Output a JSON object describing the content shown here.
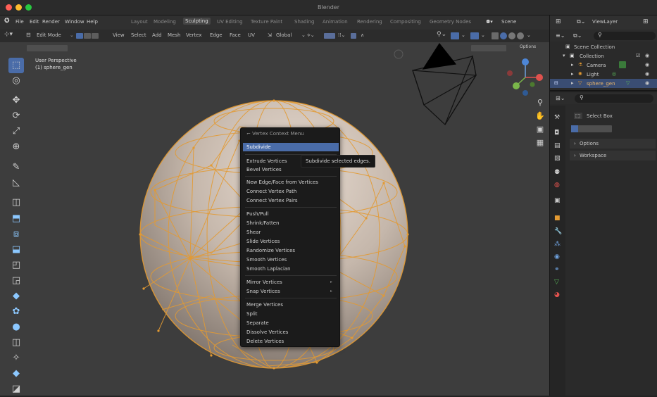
{
  "app": {
    "title": "Blender"
  },
  "menubar": {
    "items": [
      "File",
      "Edit",
      "Render",
      "Window",
      "Help"
    ],
    "workspaces": [
      "Layout",
      "Modeling",
      "Sculpting",
      "UV Editing",
      "Texture Paint",
      "Shading",
      "Animation",
      "Rendering",
      "Compositing",
      "Geometry Nodes"
    ],
    "active_workspace": "Sculpting",
    "scene": "Scene",
    "view_layer": "ViewLayer"
  },
  "header": {
    "mode": "Edit Mode",
    "menus": [
      "View",
      "Select",
      "Add",
      "Mesh",
      "Vertex",
      "Edge",
      "Face",
      "UV"
    ],
    "orientation": "Global",
    "options": "Options"
  },
  "viewport": {
    "view_name": "User Perspective",
    "object_name": "(1) sphere_gen"
  },
  "context_menu": {
    "title": "Vertex Context Menu",
    "groups": [
      [
        {
          "label": "Subdivide",
          "selected": true
        }
      ],
      [
        {
          "label": "Extrude Vertices"
        },
        {
          "label": "Bevel Vertices"
        }
      ],
      [
        {
          "label": "New Edge/Face from Vertices"
        },
        {
          "label": "Connect Vertex Path"
        },
        {
          "label": "Connect Vertex Pairs"
        }
      ],
      [
        {
          "label": "Push/Pull"
        },
        {
          "label": "Shrink/Fatten"
        },
        {
          "label": "Shear"
        },
        {
          "label": "Slide Vertices"
        },
        {
          "label": "Randomize Vertices"
        },
        {
          "label": "Smooth Vertices"
        },
        {
          "label": "Smooth Laplacian"
        }
      ],
      [
        {
          "label": "Mirror Vertices",
          "submenu": true
        },
        {
          "label": "Snap Vertices",
          "submenu": true
        }
      ],
      [
        {
          "label": "Merge Vertices"
        },
        {
          "label": "Split"
        },
        {
          "label": "Separate"
        },
        {
          "label": "Dissolve Vertices"
        },
        {
          "label": "Delete Vertices"
        }
      ]
    ]
  },
  "tooltip": {
    "text": "Subdivide selected edges."
  },
  "outliner": {
    "scene_collection": "Scene Collection",
    "collection": "Collection",
    "items": [
      "Camera",
      "Light",
      "sphere_gen"
    ],
    "selected": "sphere_gen"
  },
  "properties": {
    "tool_name": "Select Box",
    "sections": [
      "Options",
      "Workspace"
    ]
  },
  "colors": {
    "accent": "#4a6ca8",
    "wire": "#e39a32",
    "window_close": "#ff5f57",
    "window_min": "#febc2e",
    "window_max": "#28c840"
  }
}
